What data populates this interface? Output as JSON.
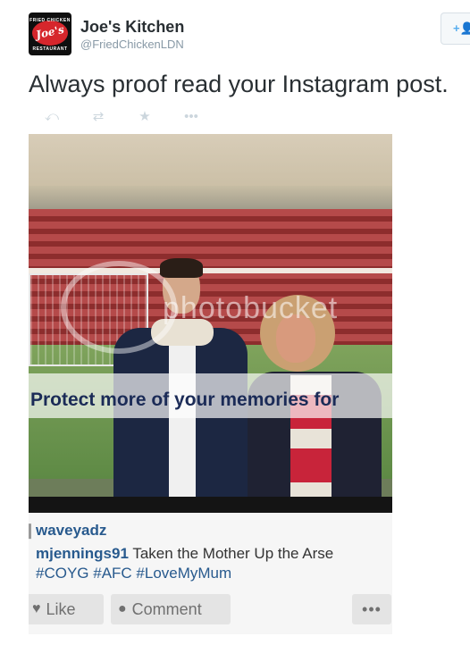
{
  "profile": {
    "display_name": "Joe's Kitchen",
    "handle": "@FriedChickenLDN",
    "logo_text": "Joe's",
    "logo_top": "FRIED CHICKEN",
    "logo_bottom": "RESTAURANT"
  },
  "follow": {
    "icon": "+👤"
  },
  "tweet": {
    "text": "Always proof read your Instagram post."
  },
  "actions": [
    {
      "name": "reply",
      "icon": "⤺"
    },
    {
      "name": "retweet",
      "icon": "⇄"
    },
    {
      "name": "favorite",
      "icon": "★"
    },
    {
      "name": "more",
      "icon": "•••"
    }
  ],
  "photo": {
    "watermark": "photobucket",
    "banner": "Protect more of your memories for",
    "instagram": {
      "author": "waveyadz",
      "commenter": "mjennings91",
      "caption": "Taken the Mother Up the Arse",
      "tags": "#COYG #AFC #LoveMyMum",
      "like_label": "Like",
      "comment_label": "Comment",
      "more_label": "•••"
    }
  },
  "colors": {
    "accent": "#55acee",
    "ig_link": "#285a8e",
    "text": "#292f33",
    "muted": "#8899a6"
  }
}
